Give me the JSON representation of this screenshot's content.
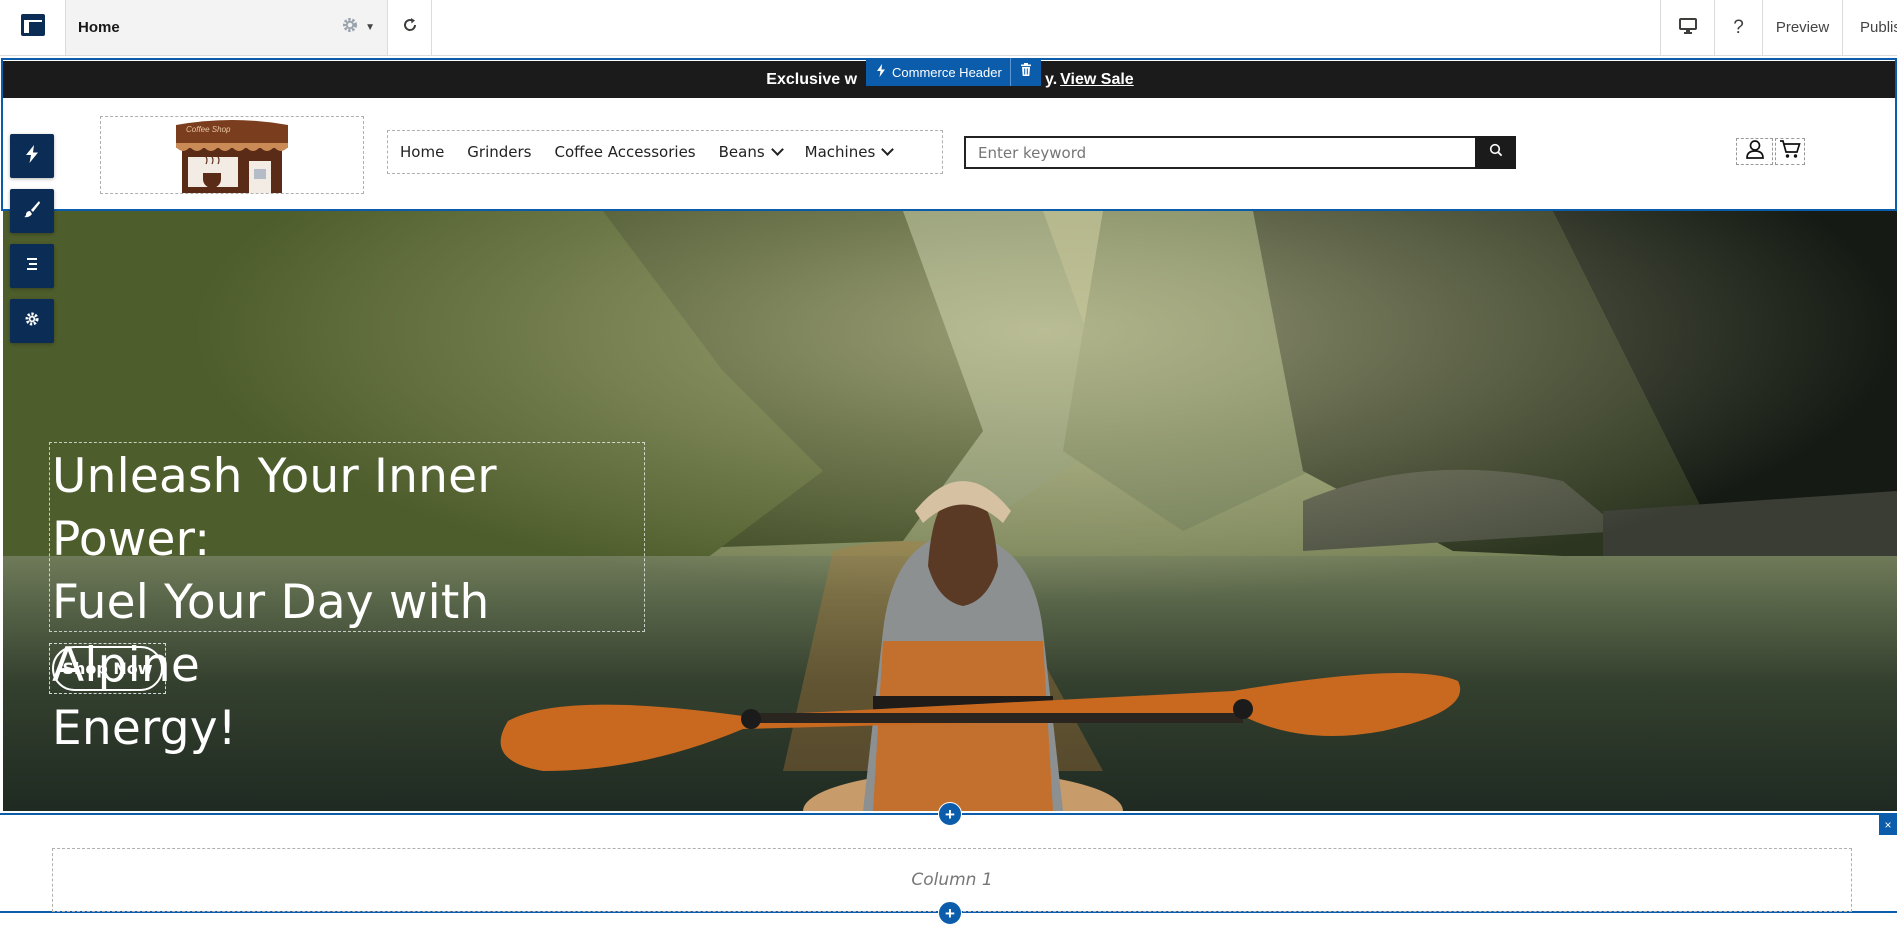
{
  "builder": {
    "page_name": "Home",
    "preview_label": "Preview",
    "publish_label": "Publis",
    "help_label": "?",
    "icons": [
      "layout-icon",
      "gear-icon",
      "caret-down-icon",
      "refresh-icon",
      "desktop-icon",
      "help-icon"
    ]
  },
  "component_label": {
    "name": "Commerce Header",
    "icons": [
      "bolt-icon",
      "trash-icon"
    ]
  },
  "announcement": {
    "text_before": "Exclusive w",
    "text_after": "y.",
    "link": "View Sale"
  },
  "header": {
    "logo_text": "Coffee Shop",
    "nav": [
      {
        "label": "Home",
        "has_dropdown": false
      },
      {
        "label": "Grinders",
        "has_dropdown": false
      },
      {
        "label": "Coffee Accessories",
        "has_dropdown": false
      },
      {
        "label": "Beans",
        "has_dropdown": true
      },
      {
        "label": "Machines",
        "has_dropdown": true
      }
    ],
    "search_placeholder": "Enter keyword",
    "icons": [
      "search-icon",
      "user-icon",
      "cart-icon"
    ]
  },
  "hero": {
    "heading_line1": "Unleash Your Inner Power:",
    "heading_line2": "Fuel Your Day with Alpine",
    "heading_line3": "Energy!",
    "button_label": "Shop Now"
  },
  "side_tools": [
    "bolt-icon",
    "brush-icon",
    "list-icon",
    "gear-icon"
  ],
  "section": {
    "column_label": "Column 1",
    "close_label": "×",
    "add_label": "+"
  },
  "colors": {
    "accent": "#0b5cab",
    "tool_bg": "#0b2c54",
    "announcement_bg": "#1b1b1b"
  }
}
